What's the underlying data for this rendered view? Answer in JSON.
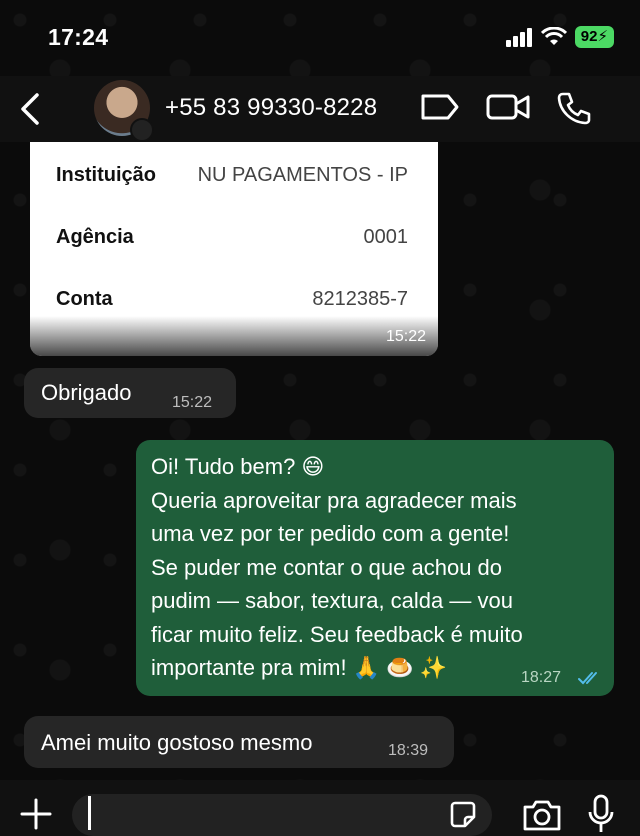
{
  "status_bar": {
    "time": "17:24",
    "battery": "92"
  },
  "header": {
    "contact": "+55 83 99330-8228"
  },
  "receipt": {
    "rows": [
      {
        "label": "Instituição",
        "value": "NU PAGAMENTOS - IP"
      },
      {
        "label": "Agência",
        "value": "0001"
      },
      {
        "label": "Conta",
        "value": "8212385-7"
      }
    ],
    "time": "15:22"
  },
  "messages": [
    {
      "direction": "in",
      "text": "Obrigado",
      "time": "15:22"
    },
    {
      "direction": "out",
      "text": "Oi! Tudo bem? 😄\nQueria aproveitar pra agradecer mais\numa vez por ter pedido com a gente!\nSe puder me contar o que achou do\npudim — sabor, textura, calda — vou\nficar muito feliz. Seu feedback é muito\nimportante pra mim! 🙏 🍮 ✨",
      "time": "18:27",
      "status": "read"
    },
    {
      "direction": "in",
      "text": "Amei muito gostoso mesmo",
      "time": "18:39"
    }
  ],
  "input": {
    "placeholder": ""
  },
  "colors": {
    "outgoing": "#1f5e3a",
    "incoming": "#262626",
    "read_ticks": "#53bdeb"
  }
}
